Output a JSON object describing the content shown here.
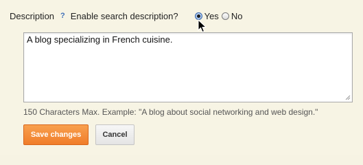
{
  "description_field": {
    "label": "Description",
    "help_icon": "?",
    "question": "Enable search description?",
    "options": [
      {
        "label": "Yes",
        "selected": true
      },
      {
        "label": "No",
        "selected": false
      }
    ],
    "value": "A blog specializing in French cuisine.",
    "hint": "150 Characters Max. Example: \"A blog about social networking and web design.\""
  },
  "actions": {
    "save_label": "Save changes",
    "cancel_label": "Cancel"
  },
  "colors": {
    "panel_background": "#f7f4e4",
    "save_button": "#f07d2a",
    "help_icon": "#3e6fb8"
  },
  "icons": {
    "cursor": "arrow-pointer-icon",
    "help": "question-mark-icon",
    "resize": "resize-grip-icon"
  }
}
